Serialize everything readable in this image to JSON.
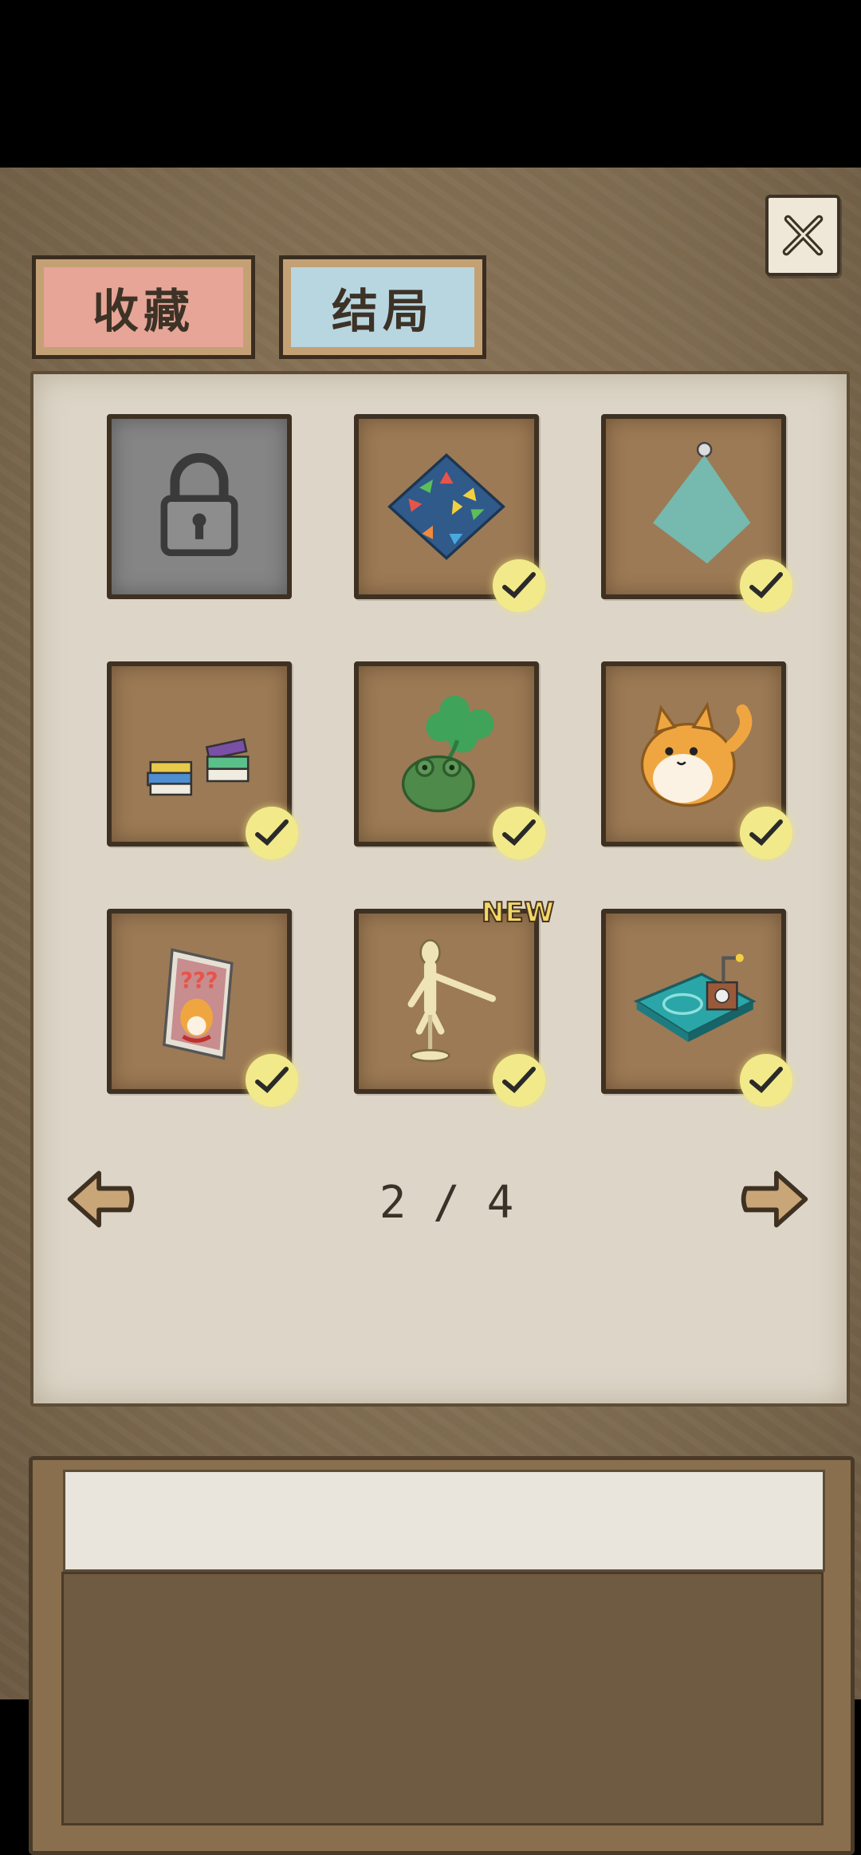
{
  "tabs": [
    {
      "label": "收藏",
      "active": true,
      "color": "#e6a596"
    },
    {
      "label": "结局",
      "active": false,
      "color": "#b8d6e0"
    }
  ],
  "close": {
    "icon": "close-icon"
  },
  "grid": {
    "items": [
      {
        "name": "locked-slot",
        "locked": true,
        "collected": false,
        "icon": "lock-icon"
      },
      {
        "name": "arrow-mat",
        "locked": false,
        "collected": true,
        "icon": "arrow-mat-icon"
      },
      {
        "name": "spotlight",
        "locked": false,
        "collected": true,
        "icon": "spotlight-icon"
      },
      {
        "name": "books",
        "locked": false,
        "collected": true,
        "icon": "books-icon"
      },
      {
        "name": "clover-frog",
        "locked": false,
        "collected": true,
        "icon": "frog-clover-icon"
      },
      {
        "name": "fat-shiba",
        "locked": false,
        "collected": true,
        "icon": "shiba-icon"
      },
      {
        "name": "shiba-poster",
        "locked": false,
        "collected": true,
        "icon": "poster-icon"
      },
      {
        "name": "wooden-mannequin",
        "locked": false,
        "collected": true,
        "icon": "mannequin-icon",
        "badge": "NEW"
      },
      {
        "name": "aquarium-device",
        "locked": false,
        "collected": true,
        "icon": "device-icon"
      }
    ]
  },
  "pagination": {
    "current": 2,
    "total": 4,
    "label": "2 / 4"
  },
  "description": {
    "title": "",
    "text": ""
  }
}
